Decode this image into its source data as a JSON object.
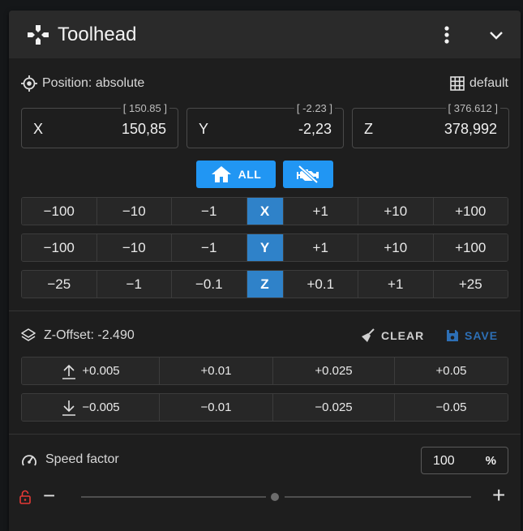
{
  "colors": {
    "accent": "#2196f3",
    "axis_cell": "#2f82c9",
    "lock_red": "#e53935",
    "save_blue": "#2d6fb5"
  },
  "header": {
    "title": "Toolhead",
    "icons": [
      "gamepad-icon",
      "dots-vertical-icon",
      "chevron-down-icon"
    ]
  },
  "position": {
    "label": "Position: absolute",
    "grid_label": "default"
  },
  "coords": [
    {
      "axis": "X",
      "value": "150,85",
      "requested": "[ 150.85 ]"
    },
    {
      "axis": "Y",
      "value": "-2,23",
      "requested": "[ -2.23 ]"
    },
    {
      "axis": "Z",
      "value": "378,992",
      "requested": "[ 376.612 ]"
    }
  ],
  "home": {
    "all_label": "ALL"
  },
  "jog": {
    "x": {
      "axis": "X",
      "minus": [
        "−100",
        "−10",
        "−1"
      ],
      "plus": [
        "+1",
        "+10",
        "+100"
      ]
    },
    "y": {
      "axis": "Y",
      "minus": [
        "−100",
        "−10",
        "−1"
      ],
      "plus": [
        "+1",
        "+10",
        "+100"
      ]
    },
    "z": {
      "axis": "Z",
      "minus": [
        "−25",
        "−1",
        "−0.1"
      ],
      "plus": [
        "+0.1",
        "+1",
        "+25"
      ]
    }
  },
  "zoffset": {
    "label": "Z-Offset: -2.490",
    "clear_label": "CLEAR",
    "save_label": "SAVE",
    "up": [
      "+0.005",
      "+0.01",
      "+0.025",
      "+0.05"
    ],
    "down": [
      "−0.005",
      "−0.01",
      "−0.025",
      "−0.05"
    ]
  },
  "speed": {
    "label": "Speed factor",
    "value": "100",
    "unit": "%",
    "minus": "−",
    "plus": "+"
  }
}
